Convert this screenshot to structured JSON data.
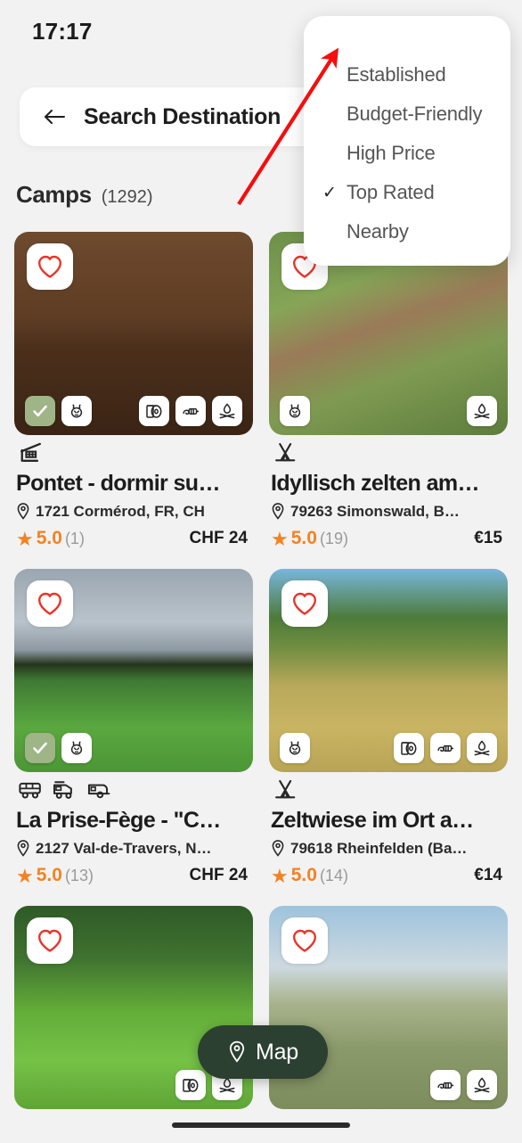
{
  "status_bar": {
    "time": "17:17",
    "wifi_icon": "wifi-icon",
    "signal_icon": "cellular-signal-icon",
    "battery_icon": "battery-icon"
  },
  "search": {
    "back_icon": "back-arrow-icon",
    "title": "Search Destination"
  },
  "section": {
    "title": "Camps",
    "count": "(1292)"
  },
  "dropdown": {
    "items": [
      {
        "label": "Established",
        "checked": false
      },
      {
        "label": "Budget-Friendly",
        "checked": false
      },
      {
        "label": "High Price",
        "checked": false
      },
      {
        "label": "Top Rated",
        "checked": true,
        "check_glyph": "✓"
      },
      {
        "label": "Nearby",
        "checked": false
      }
    ]
  },
  "map_button": {
    "label": "Map",
    "icon": "map-pin-icon",
    "color": "#2c4031"
  },
  "colors": {
    "background": "#f2f2f2",
    "card_surface": "#ffffff",
    "rating_orange": "#f58220",
    "favorite_red": "#e8342a",
    "verified_green": "#9fb487",
    "map_green": "#2c4031"
  },
  "cards": [
    {
      "title": "Pontet - dormir su…",
      "location": "1721 Cormérod, FR, CH",
      "rating": "5.0",
      "review_count": "(1)",
      "price": "CHF 24",
      "favorite_icon": "heart-outline-icon",
      "camp_type_icons": [
        "shelter-icon"
      ],
      "badges_left": [
        "verified-check-icon",
        "no-pets-icon"
      ],
      "badges_right": [
        "toilet-paper-icon",
        "water-tap-icon",
        "campfire-icon"
      ],
      "photo": "wooden-wall-with-painting"
    },
    {
      "title": "Idyllisch zelten am…",
      "location": "79263 Simonswald, B…",
      "rating": "5.0",
      "review_count": "(19)",
      "price": "€15",
      "favorite_icon": "heart-outline-icon",
      "camp_type_icons": [
        "tipi-tent-icon"
      ],
      "badges_left": [
        "no-pets-icon"
      ],
      "badges_right": [
        "campfire-icon"
      ],
      "photo": "aerial-farmhouse-village"
    },
    {
      "title": "La Prise-Fège - \"C…",
      "location": "2127 Val-de-Travers, N…",
      "rating": "5.0",
      "review_count": "(13)",
      "price": "CHF 24",
      "favorite_icon": "heart-outline-icon",
      "camp_type_icons": [
        "van-icon",
        "campervan-icon",
        "caravan-icon"
      ],
      "badges_left": [
        "verified-check-icon",
        "no-pets-icon"
      ],
      "badges_right": [],
      "photo": "green-meadow-with-forest"
    },
    {
      "title": "Zeltwiese im Ort a…",
      "location": "79618 Rheinfelden (Ba…",
      "rating": "5.0",
      "review_count": "(14)",
      "price": "€14",
      "favorite_icon": "heart-outline-icon",
      "camp_type_icons": [
        "tipi-tent-icon"
      ],
      "badges_left": [
        "no-pets-icon"
      ],
      "badges_right": [
        "toilet-paper-icon",
        "water-tap-icon",
        "campfire-icon"
      ],
      "photo": "dry-orchard-meadow"
    },
    {
      "title": "",
      "location": "",
      "rating": "",
      "review_count": "",
      "price": "",
      "favorite_icon": "heart-outline-icon",
      "camp_type_icons": [],
      "badges_left": [],
      "badges_right": [
        "toilet-paper-icon",
        "campfire-icon"
      ],
      "photo": "sunlit-grass-clearing-in-woods"
    },
    {
      "title": "",
      "location": "",
      "rating": "",
      "review_count": "",
      "price": "",
      "favorite_icon": "heart-outline-icon",
      "camp_type_icons": [],
      "badges_left": [],
      "badges_right": [
        "water-tap-icon",
        "campfire-icon"
      ],
      "photo": "winter-field-with-barn"
    }
  ],
  "annotation": {
    "type": "red-arrow",
    "points_to": "Top of sort dropdown"
  }
}
